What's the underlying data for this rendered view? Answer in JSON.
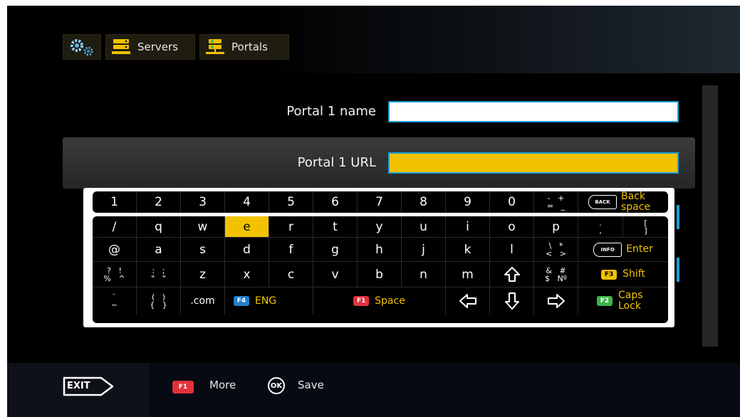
{
  "breadcrumb": {
    "settings_icon": "gears-icon",
    "servers_label": "Servers",
    "servers_icon": "server-stack-icon",
    "portals_label": "Portals",
    "portals_icon": "portal-server-icon"
  },
  "form": {
    "portal_name_label": "Portal 1 name",
    "portal_name_value": "",
    "portal_url_label": "Portal 1 URL",
    "portal_url_value": ""
  },
  "keyboard": {
    "number_row": [
      "1",
      "2",
      "3",
      "4",
      "5",
      "6",
      "7",
      "8",
      "9",
      "0"
    ],
    "symbols_pm": [
      "-",
      "+",
      "=",
      "_"
    ],
    "backspace_icon_text": "BACK",
    "backspace_label": "Back space",
    "row1": [
      "/",
      "q",
      "w",
      "e",
      "r",
      "t",
      "y",
      "u",
      "i",
      "o",
      "p"
    ],
    "row1_extra": [
      ".",
      "[",
      ",",
      "]"
    ],
    "row2": [
      "@",
      "a",
      "s",
      "d",
      "f",
      "g",
      "h",
      "j",
      "k",
      "l"
    ],
    "row2_extra": [
      "\\",
      "*",
      "<",
      ">"
    ],
    "info_icon_text": "INFO",
    "enter_label": "Enter",
    "row3_sym1": [
      "?",
      "!",
      "%",
      "^"
    ],
    "row3_sym2": [
      ":",
      ";",
      "\"",
      "\""
    ],
    "row3": [
      "z",
      "x",
      "c",
      "v",
      "b",
      "n",
      "m"
    ],
    "shift_icon": "shift-arrow-icon",
    "row3_extra": [
      "&",
      "#",
      "$",
      "Nº"
    ],
    "shift_label": "Shift",
    "row4_sym1": [
      "`",
      "~"
    ],
    "row4_sym2": [
      "(",
      ")",
      "{",
      "}"
    ],
    "dotcom_label": ".com",
    "lang_label": "ENG",
    "space_label": "Space",
    "caps_label": "Caps Lock",
    "fkeys": {
      "f1": "F1",
      "f2": "F2",
      "f3": "F3",
      "f4": "F4"
    },
    "selected_key": "e",
    "colors": {
      "selected": "#f2c200",
      "f1": "#e0323c",
      "f2": "#3cb44a",
      "f3": "#f2c200",
      "f4": "#1e7fcf"
    }
  },
  "footer": {
    "exit_label": "EXIT",
    "more_key": "F1",
    "more_label": "More",
    "ok_key": "OK",
    "save_label": "Save"
  }
}
